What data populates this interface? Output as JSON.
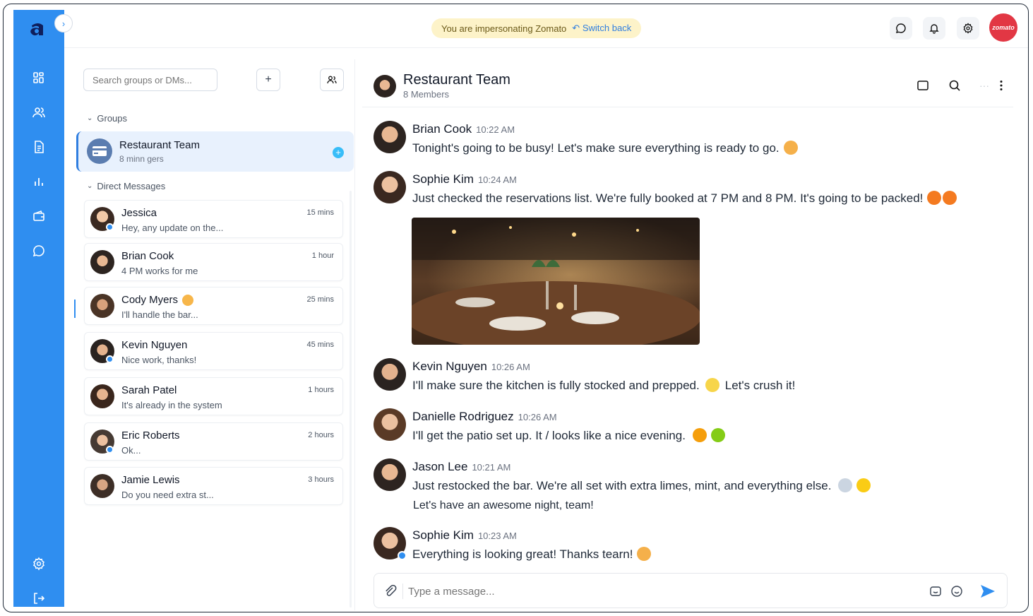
{
  "banner": {
    "text": "You are impersonating Zomato",
    "switch_label": "Switch back"
  },
  "profile": {
    "avatar_text": "zomato"
  },
  "sidebar": {
    "search_placeholder": "Search groups or DMs...",
    "groups_label": "Groups",
    "dms_label": "Direct Messages",
    "group": {
      "name": "Restaurant Team",
      "subtitle": "8 minn gers",
      "badge": "+"
    },
    "dms": [
      {
        "name": "Jessica",
        "message": "Hey, any update on the...",
        "time": "15 mins"
      },
      {
        "name": "Brian Cook",
        "message": "4 PM works for me",
        "time": "1 hour"
      },
      {
        "name": "Cody Myers",
        "message": "I'll handle the bar...",
        "time": "25 mins"
      },
      {
        "name": "Kevin Nguyen",
        "message": "Nice work, thanks!",
        "time": "45 mins"
      },
      {
        "name": "Sarah Patel",
        "message": "It's already in the system",
        "time": "1 hours"
      },
      {
        "name": "Eric Roberts",
        "message": "Ok...",
        "time": "2 hours"
      },
      {
        "name": "Jamie Lewis",
        "message": "Do you need extra st...",
        "time": "3 hours"
      }
    ]
  },
  "chat": {
    "title": "Restaurant Team",
    "subtitle": "8 Members",
    "messages": [
      {
        "author": "Brian Cook",
        "time": "10:22 AM",
        "text": "Tonight's going to be busy! Let's make sure everything is ready to go."
      },
      {
        "author": "Sophie Kim",
        "time": "10:24 AM",
        "text": "Just checked the reservations list. We're fully booked at 7 PM and 8 PM. It's going to be packed!"
      },
      {
        "author": "Kevin Nguyen",
        "time": "10:26 AM",
        "text": "I'll make sure the kitchen is fully stocked and prepped.",
        "text_after": "Let's crush it!"
      },
      {
        "author": "Danielle Rodriguez",
        "time": "10:26 AM",
        "text": "I'll get the patio set up. It  / looks like a nice evening."
      },
      {
        "author": "Jason Lee",
        "time": "10:21 AM",
        "text": "Just restocked the bar. We're all set with extra limes, mint, and everything else.",
        "text2": "Let's have an awesome night, team!"
      },
      {
        "author": "Sophie Kim",
        "time": "10:23 AM",
        "text": "Everything is looking great! Thanks tearn!"
      }
    ],
    "composer_placeholder": "Type a message..."
  },
  "colors": {
    "rail": "#2f8ef0",
    "accent": "#2f7ee0",
    "banner_bg": "#fdf3c9",
    "zomato_red": "#e23744"
  }
}
